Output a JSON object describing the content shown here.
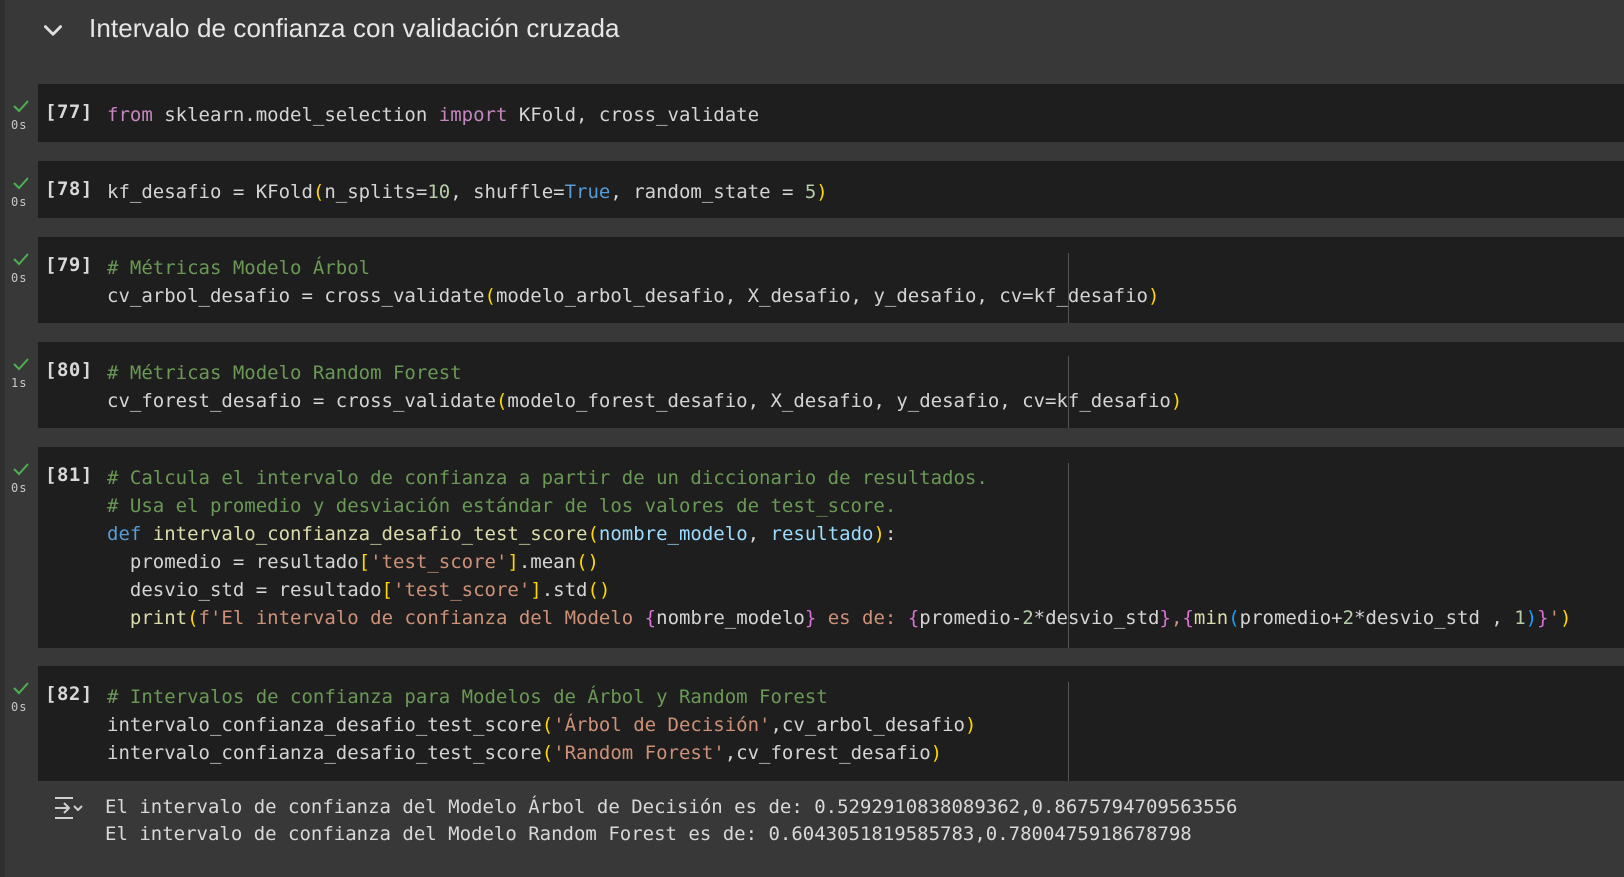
{
  "section": {
    "title": "Intervalo de confianza con validación cruzada"
  },
  "cells": [
    {
      "count": "[77]",
      "time": "0s",
      "lines": [
        "from sklearn.model_selection import KFold, cross_validate"
      ]
    },
    {
      "count": "[78]",
      "time": "0s",
      "lines": [
        "kf_desafio = KFold(n_splits=10, shuffle=True, random_state = 5)"
      ]
    },
    {
      "count": "[79]",
      "time": "0s",
      "lines": [
        "# Métricas Modelo Árbol",
        "cv_arbol_desafio = cross_validate(modelo_arbol_desafio, X_desafio, y_desafio, cv=kf_desafio)"
      ]
    },
    {
      "count": "[80]",
      "time": "1s",
      "lines": [
        "# Métricas Modelo Random Forest",
        "cv_forest_desafio = cross_validate(modelo_forest_desafio, X_desafio, y_desafio, cv=kf_desafio)"
      ]
    },
    {
      "count": "[81]",
      "time": "0s",
      "lines": [
        "# Calcula el intervalo de confianza a partir de un diccionario de resultados.",
        "# Usa el promedio y desviación estándar de los valores de test_score.",
        "def intervalo_confianza_desafio_test_score(nombre_modelo, resultado):",
        "  promedio = resultado['test_score'].mean()",
        "  desvio_std = resultado['test_score'].std()",
        "  print(f'El intervalo de confianza del Modelo {nombre_modelo} es de: {promedio-2*desvio_std},{min(promedio+2*desvio_std , 1)}')"
      ]
    },
    {
      "count": "[82]",
      "time": "0s",
      "lines": [
        "# Intervalos de confianza para Modelos de Árbol y Random Forest",
        "intervalo_confianza_desafio_test_score('Árbol de Decisión',cv_arbol_desafio)",
        "intervalo_confianza_desafio_test_score('Random Forest',cv_forest_desafio)"
      ]
    }
  ],
  "output": {
    "lines": [
      "El intervalo de confianza del Modelo Árbol de Decisión es de: 0.5292910838089362,0.8675794709563556",
      "El intervalo de confianza del Modelo Random Forest es de: 0.6043051819585783,0.7800475918678798"
    ]
  },
  "colors": {
    "background": "#383838",
    "cell": "#1e1e1e",
    "check": "#4caf50",
    "keyword": "#c586c0",
    "comment": "#6a9955",
    "string": "#ce9178",
    "number": "#b5cea8"
  },
  "icons": {
    "collapse": "chevron-down-icon",
    "success": "check-icon",
    "output": "output-icon"
  }
}
